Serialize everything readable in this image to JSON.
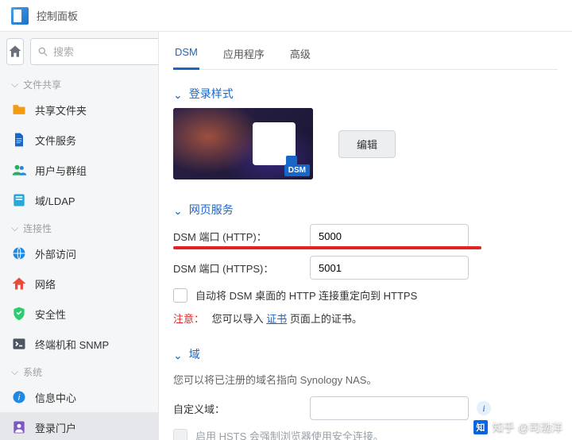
{
  "window": {
    "title": "控制面板"
  },
  "search": {
    "placeholder": "搜索"
  },
  "sidebar": {
    "groups": [
      {
        "label": "文件共享",
        "items": [
          {
            "label": "共享文件夹",
            "icon": "folder-icon",
            "color": "#f39c12"
          },
          {
            "label": "文件服务",
            "icon": "doc-icon",
            "color": "#1866c8"
          },
          {
            "label": "用户与群组",
            "icon": "users-icon",
            "color": "#27ae60"
          },
          {
            "label": "域/LDAP",
            "icon": "ldap-icon",
            "color": "#2aa7d6"
          }
        ]
      },
      {
        "label": "连接性",
        "items": [
          {
            "label": "外部访问",
            "icon": "globe-icon",
            "color": "#1e88e5"
          },
          {
            "label": "网络",
            "icon": "network-icon",
            "color": "#e74c3c"
          },
          {
            "label": "安全性",
            "icon": "shield-icon",
            "color": "#2ecc71"
          },
          {
            "label": "终端机和 SNMP",
            "icon": "terminal-icon",
            "color": "#4a5560"
          }
        ]
      },
      {
        "label": "系统",
        "items": [
          {
            "label": "信息中心",
            "icon": "info-center-icon",
            "color": "#1e88e5"
          },
          {
            "label": "登录门户",
            "icon": "login-portal-icon",
            "color": "#7e57c2",
            "active": true
          }
        ]
      }
    ]
  },
  "tabs": [
    {
      "label": "DSM",
      "active": true
    },
    {
      "label": "应用程序"
    },
    {
      "label": "高级"
    }
  ],
  "sections": {
    "login_style": {
      "title": "登录样式",
      "edit_btn": "编辑",
      "badge": "DSM"
    },
    "web_service": {
      "title": "网页服务",
      "http_label": "DSM 端口 (HTTP)：",
      "http_value": "5000",
      "https_label": "DSM 端口 (HTTPS)：",
      "https_value": "5001",
      "redirect_label": "自动将 DSM 桌面的 HTTP 连接重定向到 HTTPS",
      "note_prefix": "注意：",
      "note_before": "您可以导入 ",
      "note_link": "证书",
      "note_after": " 页面上的证书。"
    },
    "domain": {
      "title": "域",
      "desc": "您可以将已注册的域名指向 Synology NAS。",
      "custom_domain_label": "自定义域：",
      "hsts_label": "启用 HSTS 会强制浏览器使用安全连接。"
    }
  },
  "watermark": {
    "logo": "知",
    "text": "知乎 @司渤洋"
  }
}
